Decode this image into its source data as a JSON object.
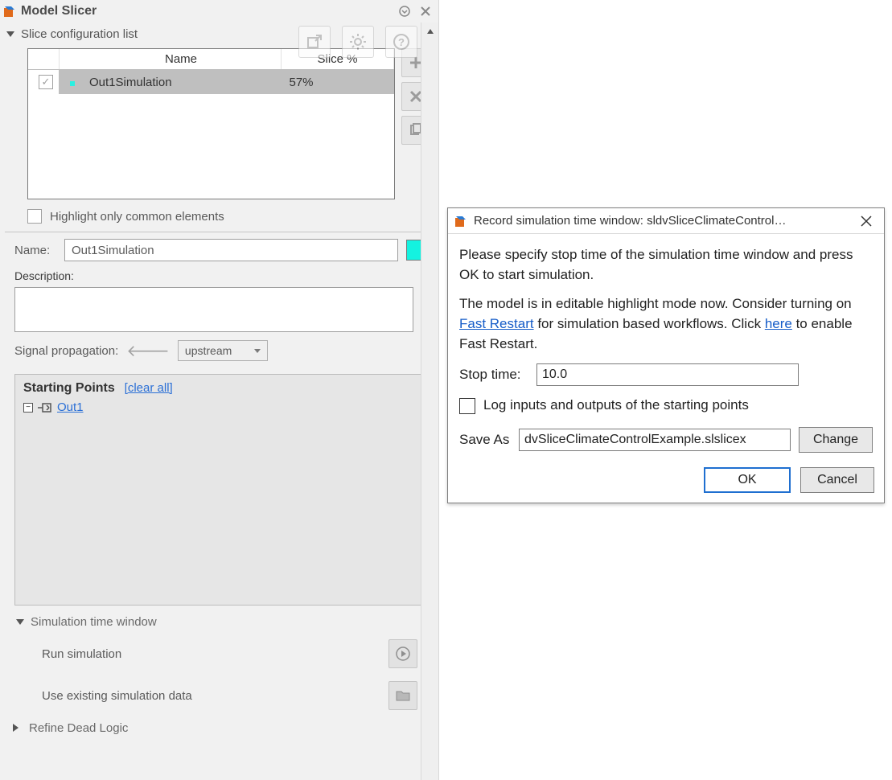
{
  "panel": {
    "title": "Model Slicer",
    "config_section_label": "Slice configuration list",
    "columns": {
      "name": "Name",
      "slice": "Slice %"
    },
    "rows": [
      {
        "name": "Out1Simulation",
        "slice": "57%"
      }
    ],
    "highlight_label": "Highlight only common elements",
    "name_label": "Name:",
    "name_value": "Out1Simulation",
    "description_label": "Description:",
    "signal_prop_label": "Signal propagation:",
    "signal_prop_value": "upstream",
    "starting_points": {
      "title": "Starting Points",
      "clear_all": "[clear all]",
      "item": "Out1 "
    },
    "sim_section_label": "Simulation time window",
    "run_label": "Run simulation",
    "use_existing_label": "Use existing simulation data",
    "refine_label": "Refine Dead Logic"
  },
  "dialog": {
    "title": "Record simulation time window: sldvSliceClimateControl…",
    "p1": "Please specify stop time of the simulation time window and press OK to start simulation.",
    "p2a": "The model is in editable highlight mode now. Consider turning on ",
    "p2_link1": "Fast Restart",
    "p2b": " for simulation based workflows. Click ",
    "p2_link2": "here",
    "p2c": " to enable Fast Restart.",
    "stop_label": "Stop time:",
    "stop_value": "10.0",
    "log_label": "Log inputs and outputs of the starting points",
    "save_label": "Save As",
    "save_value": "dvSliceClimateControlExample.slslicex",
    "change_btn": "Change",
    "ok_btn": "OK",
    "cancel_btn": "Cancel"
  }
}
